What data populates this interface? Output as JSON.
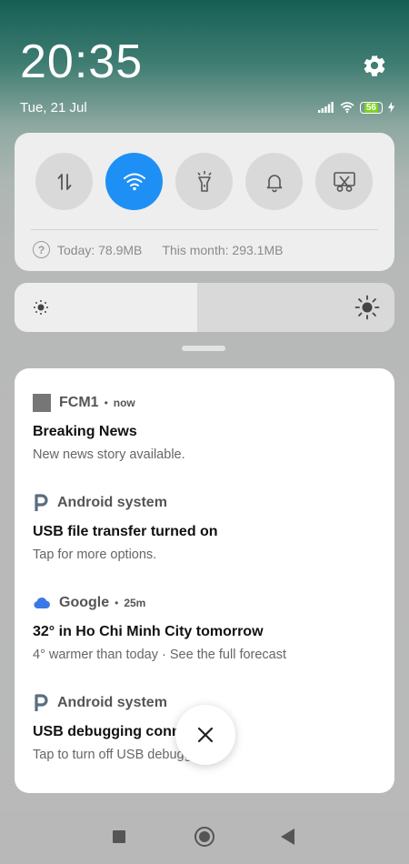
{
  "status": {
    "time": "20:35",
    "date": "Tue, 21 Jul",
    "battery": "56"
  },
  "quick_settings": {
    "toggles": [
      {
        "name": "mobile-data",
        "icon": "data-arrows-icon",
        "active": false
      },
      {
        "name": "wifi",
        "icon": "wifi-icon",
        "active": true
      },
      {
        "name": "flashlight",
        "icon": "flashlight-icon",
        "active": false
      },
      {
        "name": "sound",
        "icon": "bell-icon",
        "active": false
      },
      {
        "name": "screenshot",
        "icon": "scissors-icon",
        "active": false
      }
    ],
    "usage_today": "Today: 78.9MB",
    "usage_month": "This month: 293.1MB",
    "accent": "#1e90f5"
  },
  "brightness": {
    "level_fraction": 0.48
  },
  "notifications": [
    {
      "app": "FCM1",
      "time": "now",
      "title": "Breaking News",
      "body": "New news story available.",
      "icon": "app-square-icon"
    },
    {
      "app": "Android system",
      "time": "",
      "title": "USB file transfer turned on",
      "body": "Tap for more options.",
      "icon": "android-system-icon"
    },
    {
      "app": "Google",
      "time": "25m",
      "title": "32° in Ho Chi Minh City tomorrow",
      "body": "4° warmer than today · See the full forecast",
      "icon": "cloud-icon"
    },
    {
      "app": "Android system",
      "time": "",
      "title": "USB debugging conn",
      "body": "Tap to turn off USB debugg",
      "icon": "android-system-icon"
    }
  ]
}
